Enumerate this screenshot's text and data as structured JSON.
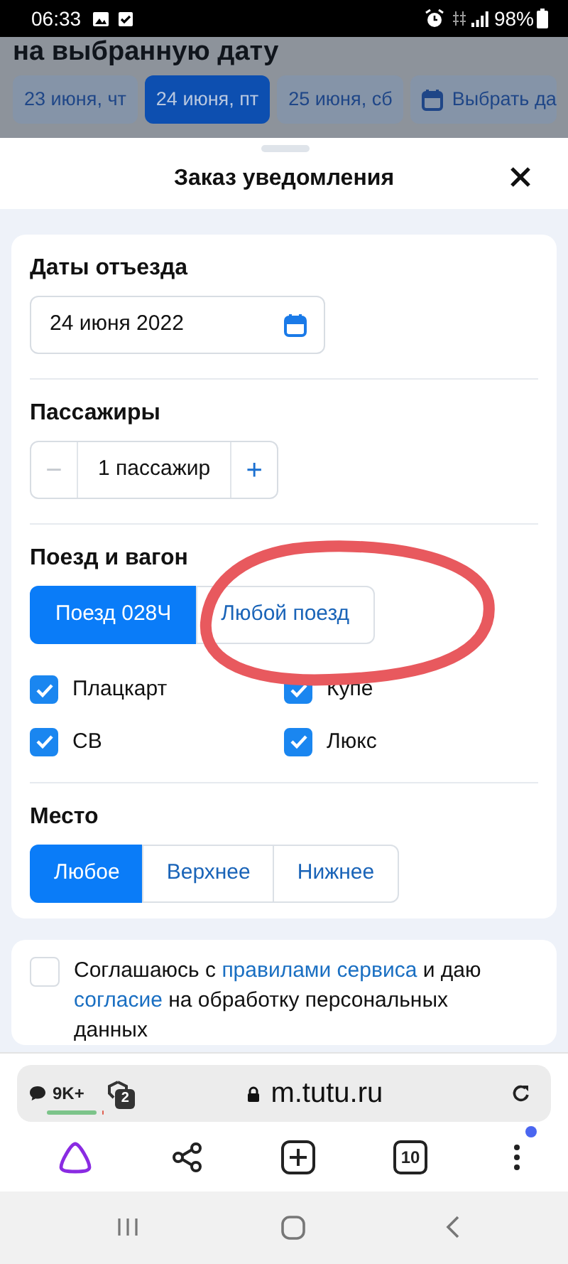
{
  "status_bar": {
    "time": "06:33",
    "battery": "98%"
  },
  "background": {
    "heading": "на выбранную дату",
    "date_chips": [
      {
        "label": "23 июня, чт",
        "selected": false,
        "kind": "date"
      },
      {
        "label": "24 июня, пт",
        "selected": true,
        "kind": "date"
      },
      {
        "label": "25 июня, сб",
        "selected": false,
        "kind": "date"
      },
      {
        "label": "Выбрать да",
        "selected": false,
        "kind": "calendar"
      }
    ]
  },
  "sheet": {
    "title": "Заказ уведомления"
  },
  "departure": {
    "heading": "Даты отъезда",
    "date_value": "24 июня 2022"
  },
  "passengers": {
    "heading": "Пассажиры",
    "minus": "−",
    "minus_disabled": true,
    "value": "1 пассажир",
    "plus": "+"
  },
  "train": {
    "heading": "Поезд и вагон",
    "options": [
      {
        "label": "Поезд 028Ч",
        "selected": true
      },
      {
        "label": "Любой поезд",
        "selected": false
      }
    ],
    "car_types": [
      {
        "label": "Плацкарт",
        "checked": true
      },
      {
        "label": "Купе",
        "checked": true
      },
      {
        "label": "СВ",
        "checked": true
      },
      {
        "label": "Люкс",
        "checked": true
      }
    ]
  },
  "seat": {
    "heading": "Место",
    "options": [
      {
        "label": "Любое",
        "selected": true
      },
      {
        "label": "Верхнее",
        "selected": false
      },
      {
        "label": "Нижнее",
        "selected": false
      }
    ]
  },
  "consent": {
    "checked": false,
    "parts": [
      {
        "text": "Соглашаюсь с ",
        "link": false
      },
      {
        "text": "правилами сервиса",
        "link": true
      },
      {
        "text": " и даю ",
        "link": false
      },
      {
        "text": "согласие",
        "link": true
      },
      {
        "text": " на обработку персональных данных",
        "link": false
      }
    ]
  },
  "browser": {
    "comments": "9K+",
    "comments_meter": {
      "level": 0.88
    },
    "tab_badge": "2",
    "url": "m.tutu.ru",
    "tabs_count": "10",
    "menu_notification": true
  },
  "annotation": {
    "kind": "circle",
    "color": "#e8595e"
  }
}
